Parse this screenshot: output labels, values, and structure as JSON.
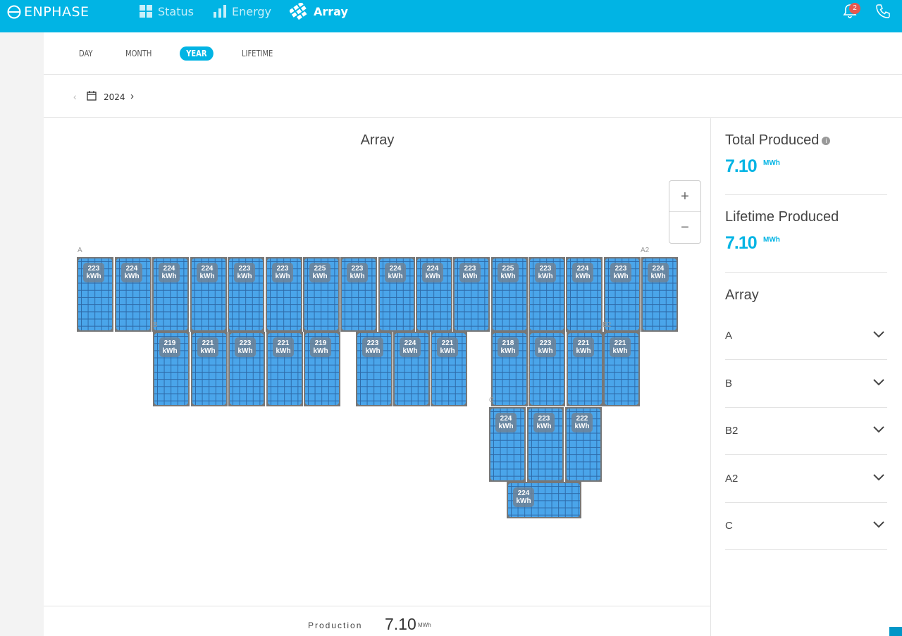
{
  "header": {
    "logo": "ENPHASE",
    "nav": [
      {
        "label": "Status",
        "icon": "grid-icon"
      },
      {
        "label": "Energy",
        "icon": "bar-chart-icon"
      },
      {
        "label": "Array",
        "icon": "array-icon"
      }
    ],
    "notification_count": "2",
    "accent_color": "#01b4e4"
  },
  "tabs": [
    "DAY",
    "MONTH",
    "YEAR",
    "LIFETIME"
  ],
  "active_tab": "YEAR",
  "date": {
    "year": "2024"
  },
  "array_view": {
    "title": "Array",
    "zoom_in": "+",
    "zoom_out": "−",
    "group_labels": [
      "A",
      "A2",
      "B",
      "B2",
      "C"
    ],
    "unit": "kWh",
    "rows": [
      [
        "223",
        "224",
        "224",
        "224",
        "223",
        "223",
        "225",
        "223",
        "224",
        "224",
        "223",
        "225",
        "223",
        "224",
        "223",
        "224"
      ],
      [
        "219",
        "221",
        "223",
        "221",
        "219",
        "223",
        "224",
        "221",
        "218",
        "223",
        "221",
        "221"
      ],
      [
        "224",
        "223",
        "222"
      ],
      [
        "224"
      ]
    ]
  },
  "production": {
    "label": "Production",
    "value": "7.10",
    "unit": "MWh"
  },
  "sidebar": {
    "total_title": "Total Produced",
    "total_value": "7.10",
    "total_unit": "MWh",
    "lifetime_title": "Lifetime Produced",
    "lifetime_value": "7.10",
    "lifetime_unit": "MWh",
    "array_title": "Array",
    "groups": [
      "A",
      "B",
      "B2",
      "A2",
      "C"
    ]
  }
}
